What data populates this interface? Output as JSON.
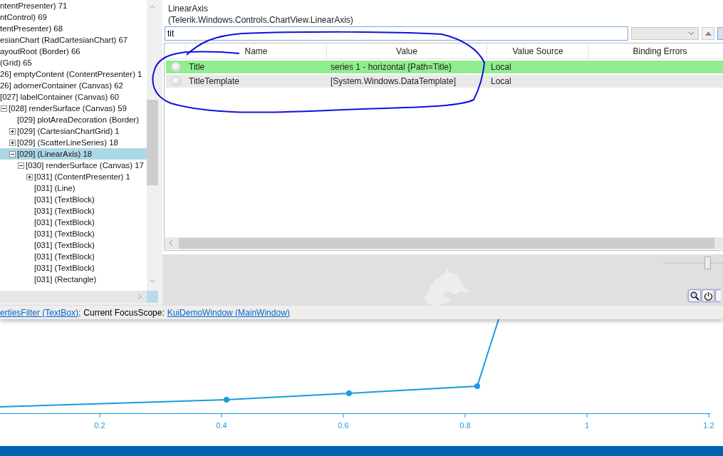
{
  "tree": {
    "items": [
      {
        "label": "ntentPresenter) 71",
        "selected": false
      },
      {
        "label": "ntControl) 69",
        "selected": false
      },
      {
        "label": "tentPresenter) 68",
        "selected": false
      },
      {
        "label": "esianChart (RadCartesianChart) 67",
        "selected": false
      },
      {
        "label": "ayoutRoot (Border) 66",
        "selected": false
      },
      {
        "label": "(Grid) 65",
        "selected": false
      },
      {
        "label": "26] emptyContent (ContentPresenter) 1",
        "selected": false
      },
      {
        "label": "26] adornerContainer (Canvas) 62",
        "selected": false
      },
      {
        "label": "[027] labelContainer (Canvas) 60",
        "selected": false,
        "children": [
          {
            "label": "[028] renderSurface (Canvas) 59",
            "selected": false,
            "expanded": true,
            "children": [
              {
                "label": "[029] plotAreaDecoration (Border)",
                "selected": false
              },
              {
                "label": "[029]  (CartesianChartGrid) 1",
                "selected": false,
                "expanded": false
              },
              {
                "label": "[029]  (ScatterLineSeries) 18",
                "selected": false,
                "expanded": false
              },
              {
                "label": "[029]  (LinearAxis) 18",
                "selected": true,
                "expanded": true,
                "children": [
                  {
                    "label": "[030] renderSurface (Canvas) 17",
                    "selected": false,
                    "expanded": true,
                    "children": [
                      {
                        "label": "[031]  (ContentPresenter) 1",
                        "selected": false,
                        "expanded": false
                      },
                      {
                        "label": "[031]  (Line)",
                        "selected": false
                      },
                      {
                        "label": "[031]  (TextBlock)",
                        "selected": false
                      },
                      {
                        "label": "[031]  (TextBlock)",
                        "selected": false
                      },
                      {
                        "label": "[031]  (TextBlock)",
                        "selected": false
                      },
                      {
                        "label": "[031]  (TextBlock)",
                        "selected": false
                      },
                      {
                        "label": "[031]  (TextBlock)",
                        "selected": false
                      },
                      {
                        "label": "[031]  (TextBlock)",
                        "selected": false
                      },
                      {
                        "label": "[031]  (TextBlock)",
                        "selected": false
                      },
                      {
                        "label": "[031]  (Rectangle)",
                        "selected": false
                      }
                    ]
                  }
                ]
              }
            ]
          }
        ]
      }
    ]
  },
  "inspector": {
    "type_name": "LinearAxis",
    "type_full_name": "(Telerik.Windows.Controls.ChartView.LinearAxis)",
    "filter": {
      "value": "tit"
    },
    "grid": {
      "columns": [
        "Name",
        "Value",
        "Value Source",
        "Binding Errors"
      ],
      "rows": [
        {
          "name": "Title",
          "value": "series 1 - horizontal {Path=Title}",
          "value_source": "Local",
          "selected": true
        },
        {
          "name": "TitleTemplate",
          "value": "[System.Windows.DataTemplate]",
          "value_source": "Local",
          "selected": false
        }
      ]
    },
    "zoom_slider": {
      "level": 0.78
    }
  },
  "status_bar": {
    "focused_element": "ertiesFilter (TextBox);",
    "text": "Current FocusScope:",
    "focus_scope": "KuiDemoWindow (MainWindow)"
  },
  "chart": {
    "x_tick_labels": [
      "0.2",
      "0.4",
      "0.6",
      "0.8",
      "1",
      "1.2"
    ]
  }
}
